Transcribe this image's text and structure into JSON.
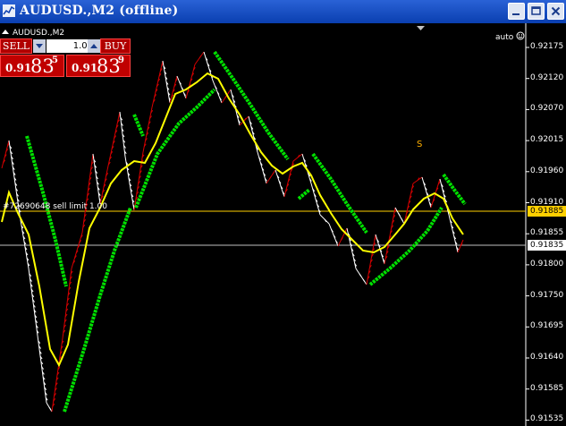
{
  "window": {
    "title": "AUDUSD.,M2 (offline)",
    "controls": [
      "minimize-icon",
      "maximize-icon",
      "close-icon"
    ]
  },
  "chart": {
    "symbol_label": "AUDUSD.,M2",
    "auto_label": "auto",
    "scale_icon": "smiley-icon",
    "price_axis": [
      "0.92175",
      "0.92120",
      "0.92070",
      "0.92015",
      "0.91960",
      "0.91910",
      "0.91855",
      "0.91800",
      "0.91750",
      "0.91695",
      "0.91640",
      "0.91585",
      "0.91535"
    ],
    "current_price_tag": "0.91835",
    "order_price_tag": "0.91885",
    "order_label": "#72690648 sell limit 1.00",
    "signal_label": "S",
    "colors": {
      "up_bars": "#d40000",
      "down_bars": "#ffffff",
      "ma": "#ffff00",
      "band": "#00e000",
      "order_line": "#ffd000",
      "price_line": "#c0c0c0"
    }
  },
  "trade_panel": {
    "sell_label": "SELL",
    "buy_label": "BUY",
    "lot_value": "1.00",
    "sell_prefix": "0.91",
    "sell_big": "83",
    "sell_sup": "5",
    "buy_prefix": "0.91",
    "buy_big": "83",
    "buy_sup": "9"
  }
}
